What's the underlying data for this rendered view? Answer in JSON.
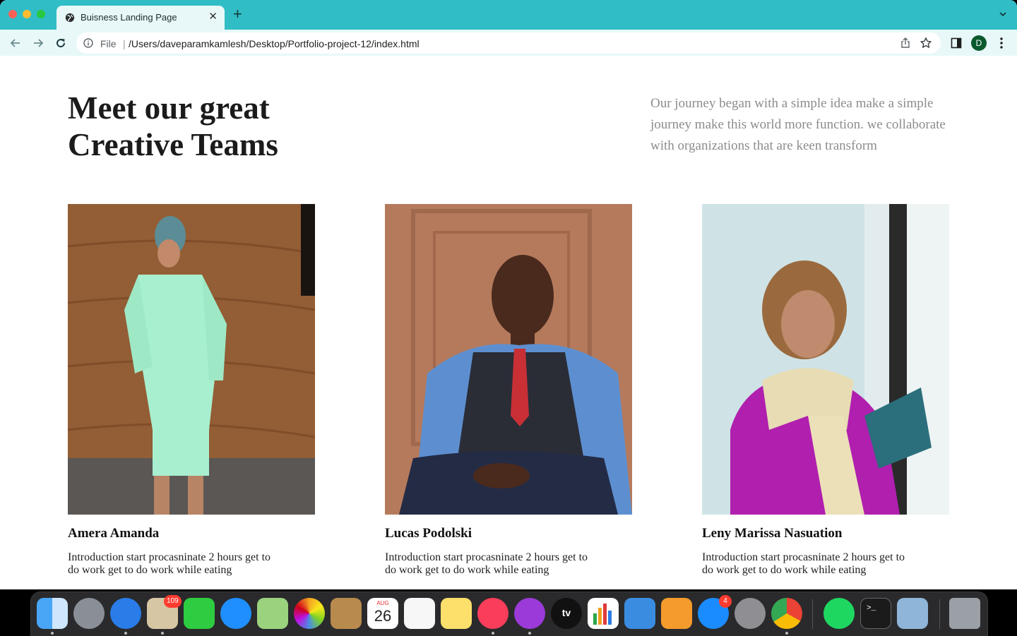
{
  "browser": {
    "tab_title": "Buisness Landing Page",
    "tab_close": "✕",
    "new_tab": "+",
    "scheme_label": "File",
    "scheme_separator": "|",
    "url": "/Users/daveparamkamlesh/Desktop/Portfolio-project-12/index.html",
    "profile_initial": "D",
    "tabbar_color": "#31bdc6",
    "toolbar_color": "#e8f8f9"
  },
  "page": {
    "heading_line1": "Meet our great",
    "heading_line2": "Creative Teams",
    "intro": "Our journey began with a simple idea make a simple journey make this world more function. we collaborate with organizations that are keen transform",
    "team": [
      {
        "name": "Amera Amanda",
        "description": "Introduction start procasninate 2 hours get to do work get to do work while eating"
      },
      {
        "name": "Lucas Podolski",
        "description": "Introduction start procasninate 2 hours get to do work get to do work while eating"
      },
      {
        "name": "Leny Marissa Nasuation",
        "description": "Introduction start procasninate 2 hours get to do work get to do work while eating"
      }
    ]
  },
  "dock": {
    "mail_badge": "109",
    "appstore_badge": "4",
    "calendar_month": "AUG",
    "calendar_day": "26",
    "tv_label": "tv",
    "terminal_prompt": ">_",
    "apps": [
      "finder-icon",
      "launchpad-icon",
      "safari-icon",
      "mail-icon",
      "facetime-icon",
      "messages-icon",
      "maps-icon",
      "photos-icon",
      "contacts-icon",
      "calendar-icon",
      "reminders-icon",
      "notes-icon",
      "music-icon",
      "podcasts-icon",
      "tv-icon",
      "numbers-icon",
      "keynote-icon",
      "pages-icon",
      "app-store-icon",
      "system-preferences-icon",
      "chrome-icon",
      "spotify-icon",
      "terminal-icon",
      "preview-icon",
      "trash-icon"
    ]
  }
}
